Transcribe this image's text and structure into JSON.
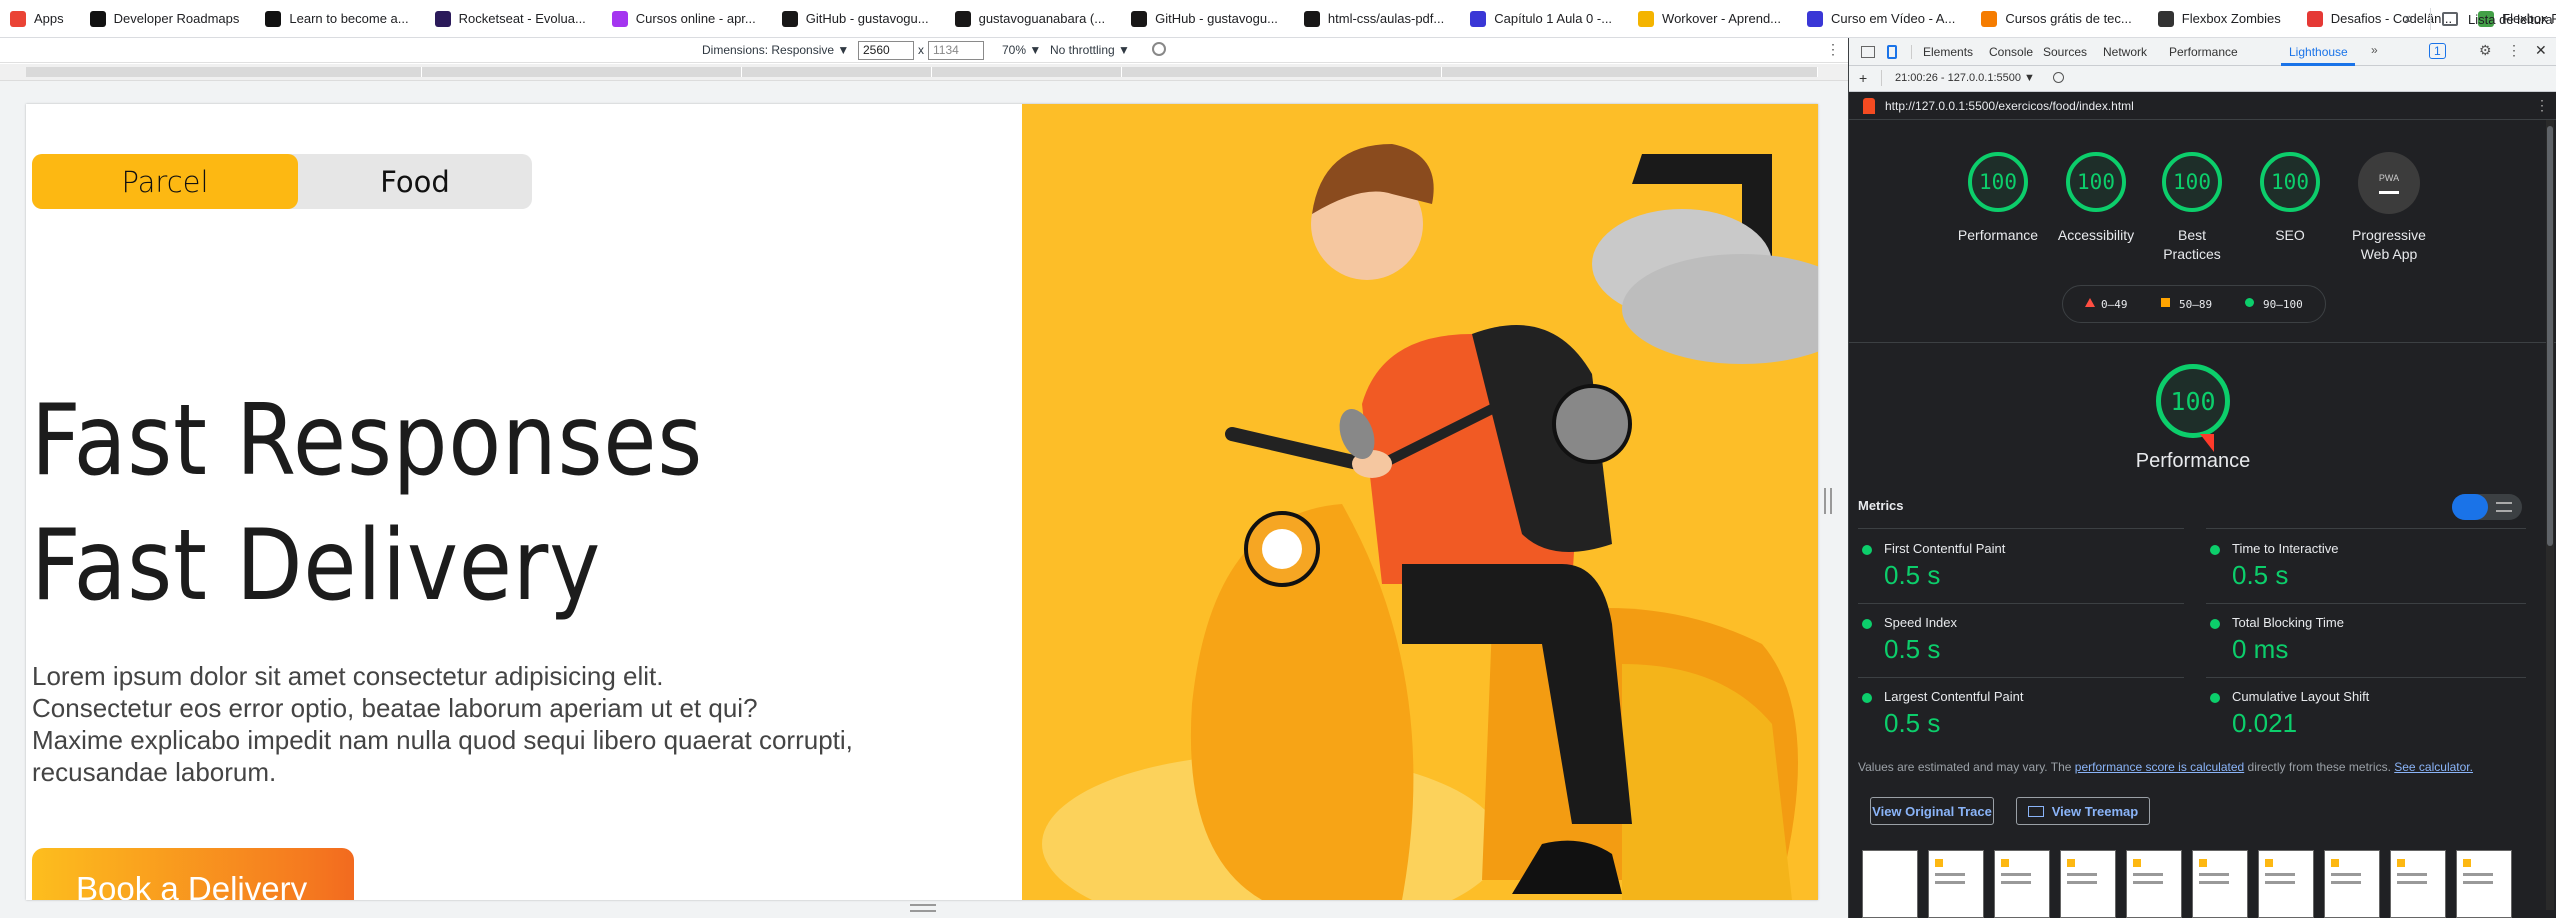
{
  "bookmarks": [
    {
      "label": "Apps",
      "icon": "apps-grid-icon",
      "color": "#ea4335"
    },
    {
      "label": "Developer Roadmaps",
      "icon": "roadmap-icon",
      "color": "#111111"
    },
    {
      "label": "Learn to become a...",
      "icon": "roadmap-icon",
      "color": "#111111"
    },
    {
      "label": "Rocketseat - Evolua...",
      "icon": "rocket-icon",
      "color": "#2b1a5a"
    },
    {
      "label": "Cursos online - apr...",
      "icon": "course-icon",
      "color": "#a435f0"
    },
    {
      "label": "GitHub - gustavogu...",
      "icon": "github-icon",
      "color": "#181717"
    },
    {
      "label": "gustavoguanabara (...",
      "icon": "github-icon",
      "color": "#181717"
    },
    {
      "label": "GitHub - gustavogu...",
      "icon": "github-icon",
      "color": "#181717"
    },
    {
      "label": "html-css/aulas-pdf...",
      "icon": "github-icon",
      "color": "#181717"
    },
    {
      "label": "Capítulo 1 Aula 0 -...",
      "icon": "video-icon",
      "color": "#3a37d6"
    },
    {
      "label": "Workover - Aprend...",
      "icon": "workover-icon",
      "color": "#f4b400"
    },
    {
      "label": "Curso em Vídeo - A...",
      "icon": "video-icon",
      "color": "#3a37d6"
    },
    {
      "label": "Cursos grátis de tec...",
      "icon": "course-icon",
      "color": "#f57c00"
    },
    {
      "label": "Flexbox Zombies",
      "icon": "zombie-icon",
      "color": "#333333"
    },
    {
      "label": "Desafios - Codelân...",
      "icon": "code-icon",
      "color": "#e53935"
    },
    {
      "label": "Flexbox Froggy - A...",
      "icon": "frog-icon",
      "color": "#43a047"
    }
  ],
  "reading_list": "Lista de leitura",
  "device_toolbar": {
    "dimensions": "Dimensions: Responsive ▼",
    "width": "2560",
    "times": "x",
    "height": "1134",
    "zoom": "70% ▼",
    "throttle": "No throttling ▼"
  },
  "page": {
    "tab_parcel": "Parcel",
    "tab_food": "Food",
    "headline_1": "Fast Responses",
    "headline_2": "Fast Delivery",
    "lorem_1": "Lorem ipsum dolor sit amet consectetur adipisicing elit.",
    "lorem_2": "Consectetur eos error optio, beatae laborum aperiam ut et qui?",
    "lorem_3": "Maxime explicabo impedit nam nulla quod sequi libero quaerat corrupti,",
    "lorem_4": "recusandae laborum.",
    "cta": "Book a Delivery",
    "colors": {
      "accent": "#fdb812",
      "illustration_bg": "#fdbe28",
      "cta_end": "#f26a1f"
    }
  },
  "devtools": {
    "tabs": [
      "Elements",
      "Console",
      "Sources",
      "Network",
      "Performance",
      "Lighthouse"
    ],
    "active_tab": "Lighthouse",
    "more": "»",
    "issues_count": "1",
    "report_label": "21:00:26 - 127.0.0.1:5500 ▼",
    "url": "http://127.0.0.1:5500/exercicos/food/index.html",
    "scores": [
      {
        "label": "Performance",
        "value": "100"
      },
      {
        "label": "Accessibility",
        "value": "100"
      },
      {
        "label": "Best Practices",
        "value": "100"
      },
      {
        "label": "SEO",
        "value": "100"
      }
    ],
    "pwa_label": "Progressive Web App",
    "pwa_badge": "PWA",
    "legend": {
      "fail": "0–49",
      "average": "50–89",
      "pass": "90–100"
    },
    "big_score": "100",
    "big_label": "Performance",
    "metrics_title": "Metrics",
    "metrics": [
      {
        "name": "First Contentful Paint",
        "value": "0.5 s"
      },
      {
        "name": "Time to Interactive",
        "value": "0.5 s"
      },
      {
        "name": "Speed Index",
        "value": "0.5 s"
      },
      {
        "name": "Total Blocking Time",
        "value": "0 ms"
      },
      {
        "name": "Largest Contentful Paint",
        "value": "0.5 s"
      },
      {
        "name": "Cumulative Layout Shift",
        "value": "0.021"
      }
    ],
    "note_prefix": "Values are estimated and may vary. The ",
    "note_link1": "performance score is calculated",
    "note_mid": " directly from these metrics. ",
    "note_link2": "See calculator.",
    "btn_trace": "View Original Trace",
    "btn_treemap": "View Treemap",
    "colors": {
      "pass": "#0cce6b",
      "average": "#ffa400",
      "fail": "#ff4e42",
      "link": "#8ab4f8"
    }
  }
}
